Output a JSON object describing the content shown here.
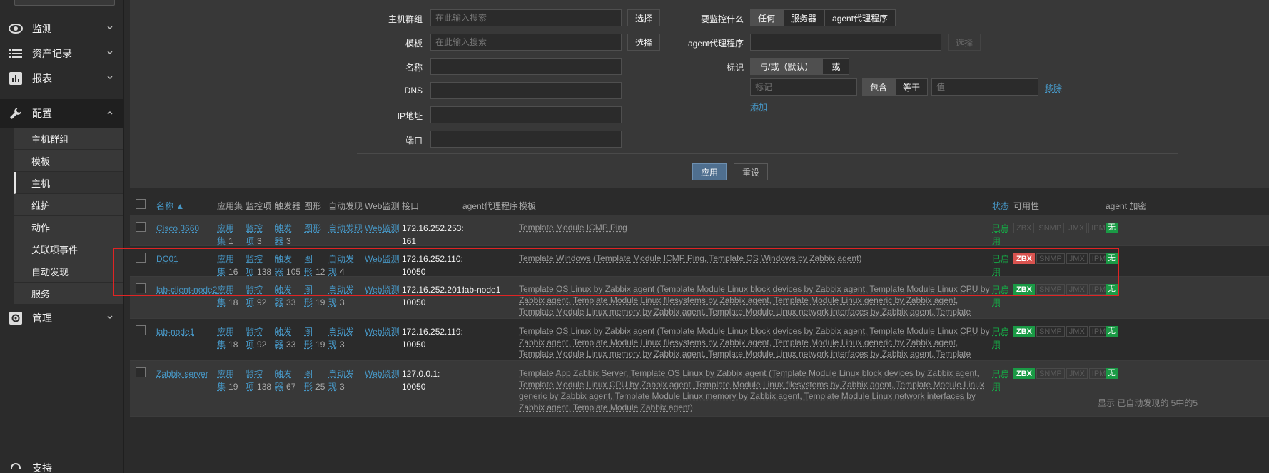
{
  "sidebar": {
    "menus": [
      {
        "label": "监测",
        "icon": "eye-icon"
      },
      {
        "label": "资产记录",
        "icon": "list-icon"
      },
      {
        "label": "报表",
        "icon": "chart-icon"
      },
      {
        "label": "配置",
        "icon": "wrench-icon"
      },
      {
        "label": "管理",
        "icon": "gear-icon"
      },
      {
        "label": "支持",
        "icon": "headset-icon"
      }
    ],
    "submenu": [
      "主机群组",
      "模板",
      "主机",
      "维护",
      "动作",
      "关联项事件",
      "自动发现",
      "服务"
    ]
  },
  "filter": {
    "host_groups_label": "主机群组",
    "templates_label": "模板",
    "name_label": "名称",
    "dns_label": "DNS",
    "ip_label": "IP地址",
    "port_label": "端口",
    "search_placeholder": "在此输入搜索",
    "select_label": "选择",
    "monitor_label": "要监控什么",
    "monitor_options": [
      "任何",
      "服务器",
      "agent代理程序"
    ],
    "proxy_label": "agent代理程序",
    "tags_label": "标记",
    "tags_mode": [
      "与/或（默认）",
      "或"
    ],
    "tag_placeholder": "标记",
    "tag_ops": [
      "包含",
      "等于"
    ],
    "value_placeholder": "值",
    "remove_label": "移除",
    "add_label": "添加",
    "apply_label": "应用",
    "reset_label": "重设"
  },
  "table": {
    "headers": {
      "name": "名称 ▲",
      "applications": "应用集",
      "items": "监控项",
      "triggers": "触发器",
      "graphs": "图形",
      "discovery": "自动发现",
      "web": "Web监测",
      "interface": "接口",
      "proxy": "agent代理程序",
      "templates": "模板",
      "status": "状态",
      "availability": "可用性",
      "encryption": "agent 加密"
    },
    "availability_tags": [
      "ZBX",
      "SNMP",
      "JMX",
      "IPMI"
    ],
    "status_enabled": "已启用",
    "encryption_none": "无",
    "rows": [
      {
        "name": "Cisco 3660",
        "app": "应用",
        "app2": "集",
        "app_cnt": "1",
        "items": "监控",
        "items2": "项",
        "items_cnt": "3",
        "triggers": "触发",
        "triggers2": "器",
        "triggers_cnt": "3",
        "graphs": "图形",
        "graphs2": "",
        "graphs_cnt": "",
        "disc": "自动发现",
        "disc2": "",
        "disc_cnt": "",
        "web": "Web监测",
        "iface1": "172.16.252.253:",
        "iface2": "161",
        "proxy": "",
        "templates": "Template Module ICMP Ping",
        "zbx": "off"
      },
      {
        "name": "DC01",
        "app": "应用",
        "app2": "集",
        "app_cnt": "16",
        "items": "监控",
        "items2": "项",
        "items_cnt": "138",
        "triggers": "触发",
        "triggers2": "器",
        "triggers_cnt": "105",
        "graphs": "图",
        "graphs2": "形",
        "graphs_cnt": "12",
        "disc": "自动发",
        "disc2": "现",
        "disc_cnt": "4",
        "web": "Web监测",
        "iface1": "172.16.252.110:",
        "iface2": "10050",
        "proxy": "",
        "templates": "Template Windows (Template Module ICMP Ping, Template OS Windows by Zabbix agent)",
        "zbx": "err"
      },
      {
        "name": "lab-client-node2",
        "app": "应用",
        "app2": "集",
        "app_cnt": "18",
        "items": "监控",
        "items2": "项",
        "items_cnt": "92",
        "triggers": "触发",
        "triggers2": "器",
        "triggers_cnt": "33",
        "graphs": "图",
        "graphs2": "形",
        "graphs_cnt": "19",
        "disc": "自动发",
        "disc2": "现",
        "disc_cnt": "3",
        "web": "Web监测",
        "iface1": "172.16.252.201:",
        "iface2": "10050",
        "proxy": "lab-node1",
        "templates": "Template OS Linux by Zabbix agent (Template Module Linux block devices by Zabbix agent, Template Module Linux CPU by Zabbix agent, Template Module Linux filesystems by Zabbix agent, Template Module Linux generic by Zabbix agent, Template Module Linux memory by Zabbix agent, Template Module Linux network interfaces by Zabbix agent, Template Module Zabbix agent)",
        "zbx": "on"
      },
      {
        "name": "lab-node1",
        "app": "应用",
        "app2": "集",
        "app_cnt": "18",
        "items": "监控",
        "items2": "项",
        "items_cnt": "92",
        "triggers": "触发",
        "triggers2": "器",
        "triggers_cnt": "33",
        "graphs": "图",
        "graphs2": "形",
        "graphs_cnt": "19",
        "disc": "自动发",
        "disc2": "现",
        "disc_cnt": "3",
        "web": "Web监测",
        "iface1": "172.16.252.119:",
        "iface2": "10050",
        "proxy": "",
        "templates": "Template OS Linux by Zabbix agent (Template Module Linux block devices by Zabbix agent, Template Module Linux CPU by Zabbix agent, Template Module Linux filesystems by Zabbix agent, Template Module Linux generic by Zabbix agent, Template Module Linux memory by Zabbix agent, Template Module Linux network interfaces by Zabbix agent, Template Module Zabbix agent)",
        "zbx": "on"
      },
      {
        "name": "Zabbix server",
        "app": "应用",
        "app2": "集",
        "app_cnt": "19",
        "items": "监控",
        "items2": "项",
        "items_cnt": "138",
        "triggers": "触发",
        "triggers2": "器",
        "triggers_cnt": "67",
        "graphs": "图",
        "graphs2": "形",
        "graphs_cnt": "25",
        "disc": "自动发",
        "disc2": "现",
        "disc_cnt": "3",
        "web": "Web监测",
        "iface1": "127.0.0.1:",
        "iface2": "10050",
        "proxy": "",
        "templates": "Template App Zabbix Server, Template OS Linux by Zabbix agent (Template Module Linux block devices by Zabbix agent, Template Module Linux CPU by Zabbix agent, Template Module Linux filesystems by Zabbix agent, Template Module Linux generic by Zabbix agent, Template Module Linux memory by Zabbix agent, Template Module Linux network interfaces by Zabbix agent, Template Module Zabbix agent)",
        "zbx": "on"
      }
    ],
    "footer": "显示 已自动发现的 5中的5"
  },
  "colors": {
    "accent": "#4796c4",
    "green": "#17a545",
    "red": "#d9534f",
    "highlight": "#e02424"
  }
}
